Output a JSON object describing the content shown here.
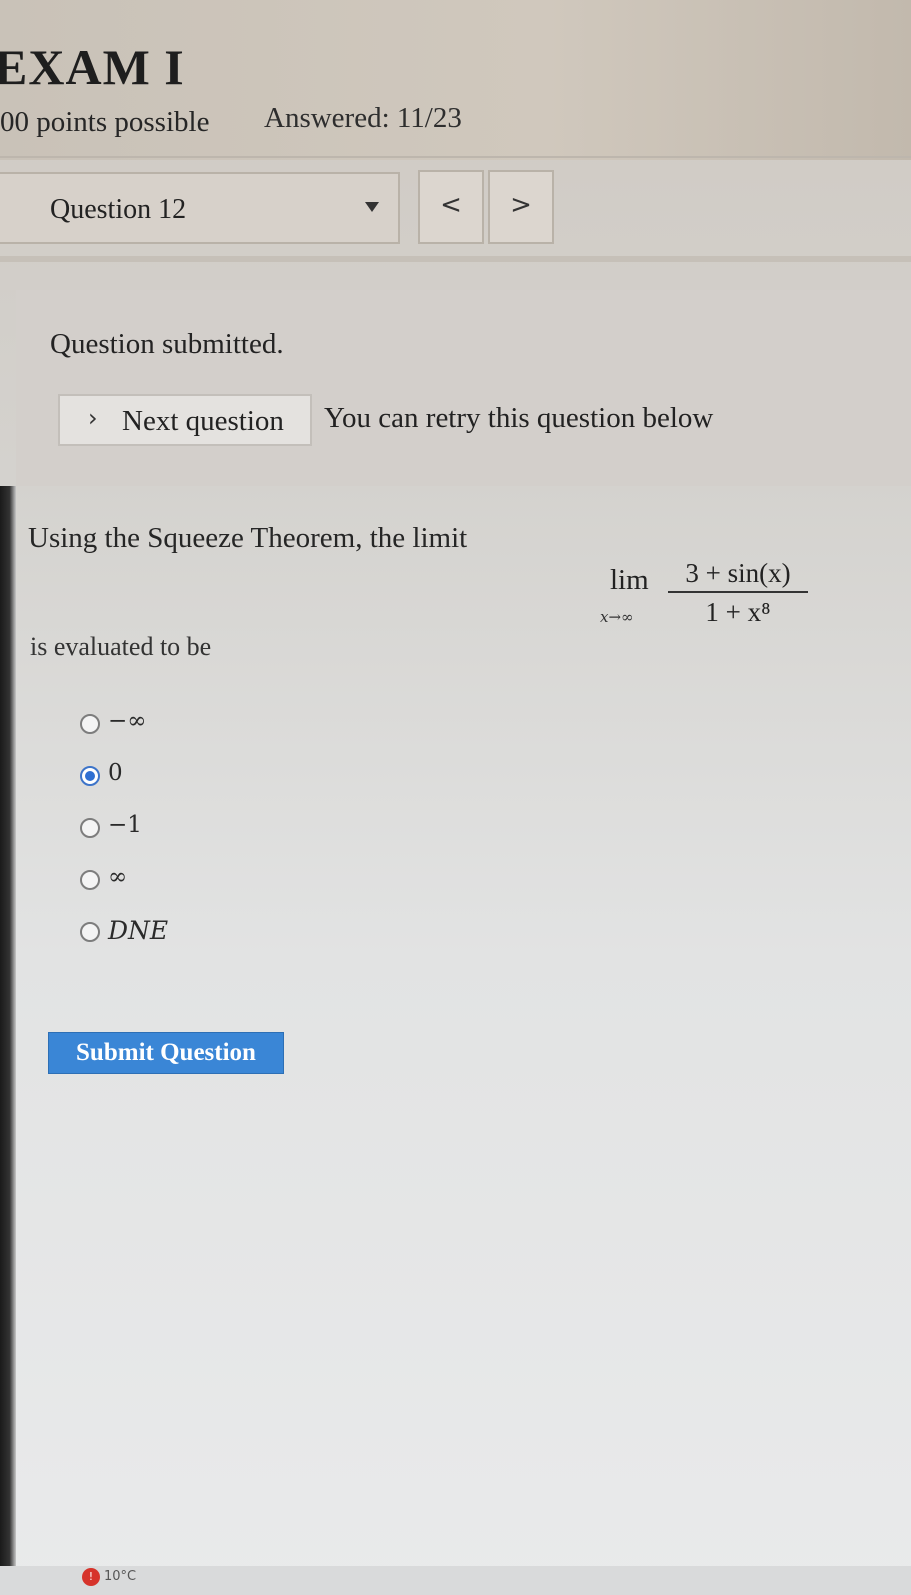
{
  "header": {
    "title": "EXAM I",
    "points": "00 points possible",
    "answered": "Answered: 11/23"
  },
  "question_nav": {
    "selected": "Question 12",
    "prev_label": "<",
    "next_label": ">"
  },
  "notice": {
    "status": "Question submitted.",
    "next_button_label": "Next question",
    "next_button_icon": "chevron-right-icon",
    "retry_text": "You can retry this question below"
  },
  "question": {
    "prompt": "Using the Squeeze Theorem, the limit",
    "formula": {
      "operator": "lim",
      "subscript": "x→∞",
      "numerator": "3 + sin(x)",
      "denominator": "1 + x⁸"
    },
    "suffix": "is evaluated to be",
    "options": [
      {
        "label": "−∞",
        "selected": false
      },
      {
        "label": "0",
        "selected": true
      },
      {
        "label": "−1",
        "selected": false
      },
      {
        "label": "∞",
        "selected": false
      },
      {
        "label": "DNE",
        "selected": false
      }
    ],
    "submit_label": "Submit Question"
  },
  "taskbar": {
    "weather_temp": "10°C",
    "alert_badge": "!"
  },
  "colors": {
    "accent": "#3a86d6",
    "radio_selected": "#2f6fd2"
  }
}
